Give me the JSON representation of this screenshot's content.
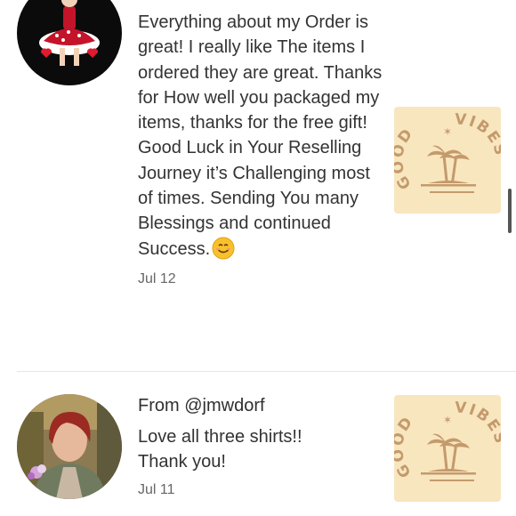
{
  "reviews": [
    {
      "from": "",
      "body": "Everything about my Order is great! I really like The items I ordered they are great. Thanks for How well you packaged my items, thanks for the free gift! Good Luck in Your Reselling Journey it’s Challenging most of times. Sending You many Blessings and continued Success.",
      "emoji": "smiling-face-emoji",
      "date": "Jul 12",
      "product_logo": {
        "top": "GOOD",
        "right": "VIBES",
        "icon": "palm-trees-icon"
      }
    },
    {
      "from": "From @jmwdorf",
      "body": "Love all three shirts!! Thank you!",
      "date": "Jul 11",
      "product_logo": {
        "top": "GOOD",
        "right": "VIBES",
        "icon": "palm-trees-icon"
      }
    }
  ],
  "colors": {
    "product_bg": "#f8e6bf",
    "logo": "#c49a6c",
    "divider": "#e6e6e6"
  }
}
